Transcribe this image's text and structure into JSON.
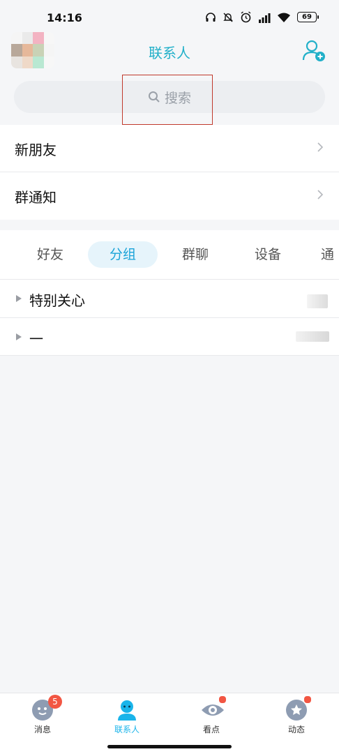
{
  "status_bar": {
    "time": "14:16",
    "battery": "69"
  },
  "header": {
    "title": "联系人"
  },
  "search": {
    "placeholder": "搜索"
  },
  "list": {
    "new_friends": "新朋友",
    "group_notice": "群通知"
  },
  "tabs": [
    "好友",
    "分组",
    "群聊",
    "设备",
    "通"
  ],
  "active_tab": "分组",
  "groups": [
    {
      "label": "特别关心"
    },
    {
      "label": "一"
    }
  ],
  "bottom_nav": [
    {
      "label": "消息",
      "badge": "5"
    },
    {
      "label": "联系人",
      "active": true
    },
    {
      "label": "看点",
      "dot": true
    },
    {
      "label": "动态",
      "dot": true
    }
  ],
  "colors": {
    "accent": "#22b0c9",
    "tab_active": "#1aa3d8",
    "badge": "#f25643"
  }
}
